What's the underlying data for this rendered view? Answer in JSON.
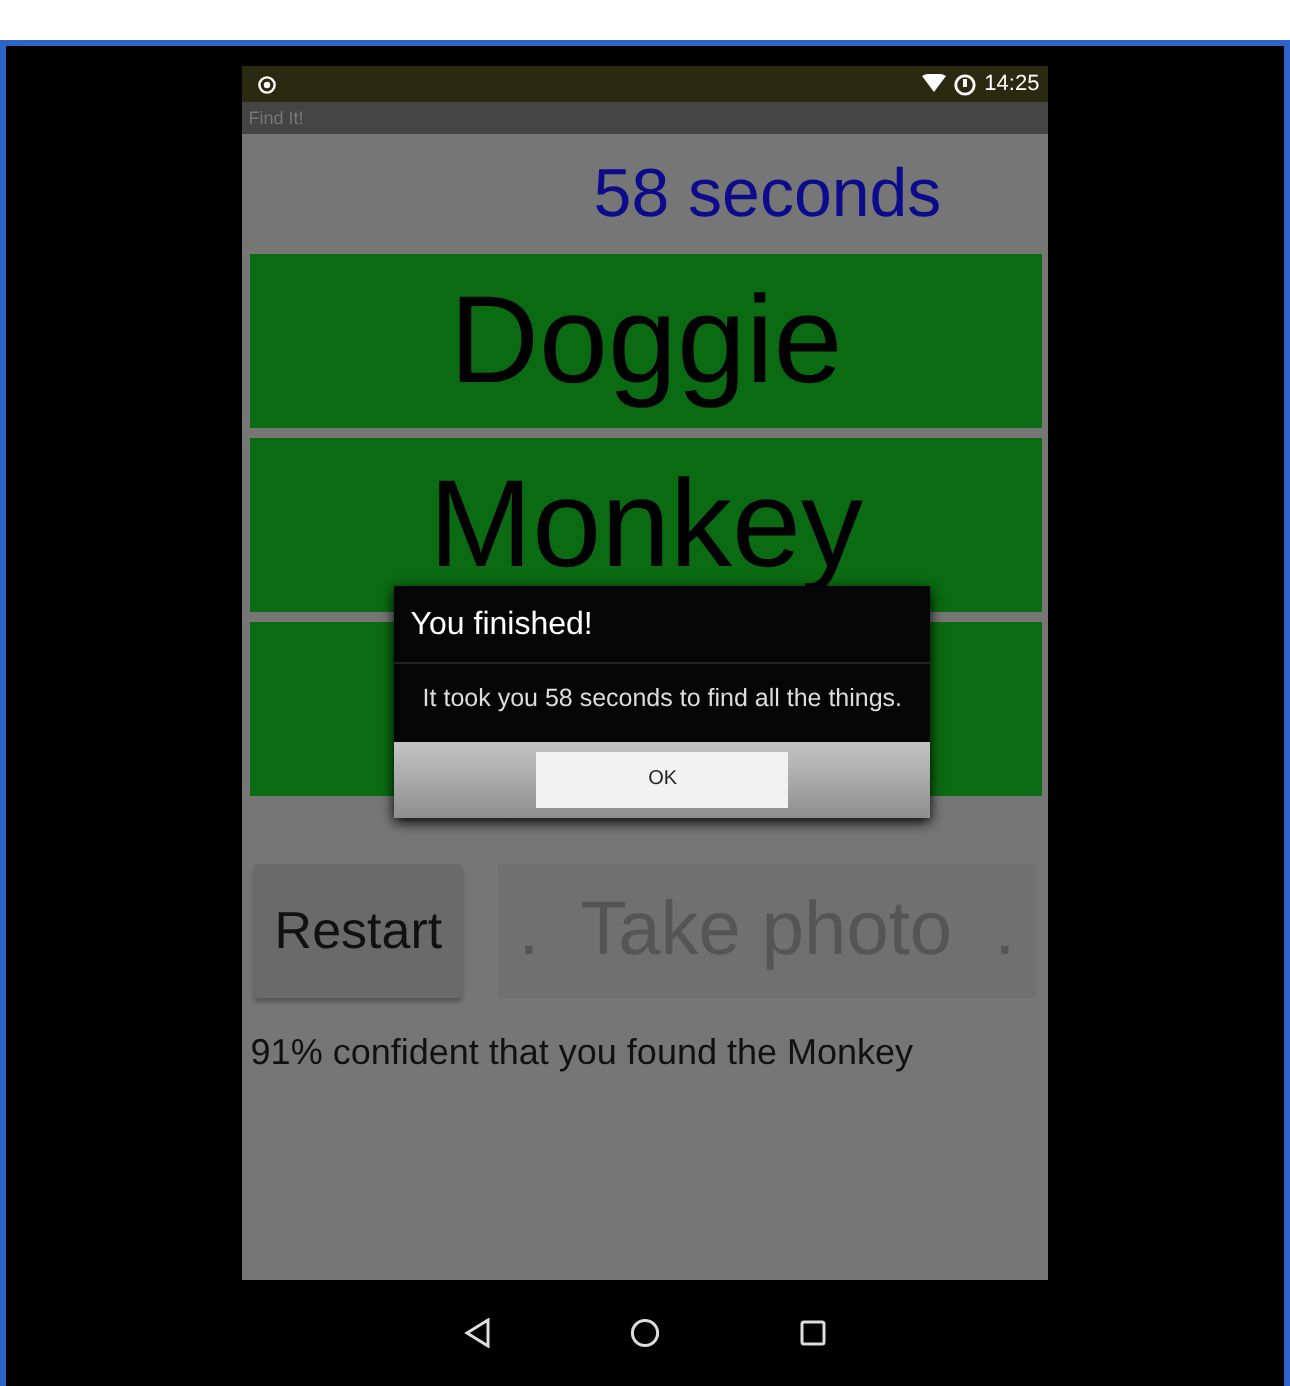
{
  "status_bar": {
    "time": "14:25"
  },
  "app_title": "Find It!",
  "timer": "58 seconds",
  "targets": [
    {
      "kind": "word",
      "label": "Doggie"
    },
    {
      "kind": "word",
      "label": "Monkey"
    },
    {
      "kind": "covered"
    }
  ],
  "dialog": {
    "title": "You finished!",
    "message": "It took you 58 seconds to find all the things.",
    "button": "OK"
  },
  "buttons": [
    {
      "label": "Restart",
      "disabled": false
    },
    {
      "label": ".  Take photo  .",
      "disabled": true
    }
  ],
  "result": "91% confident that you found the Monkey"
}
